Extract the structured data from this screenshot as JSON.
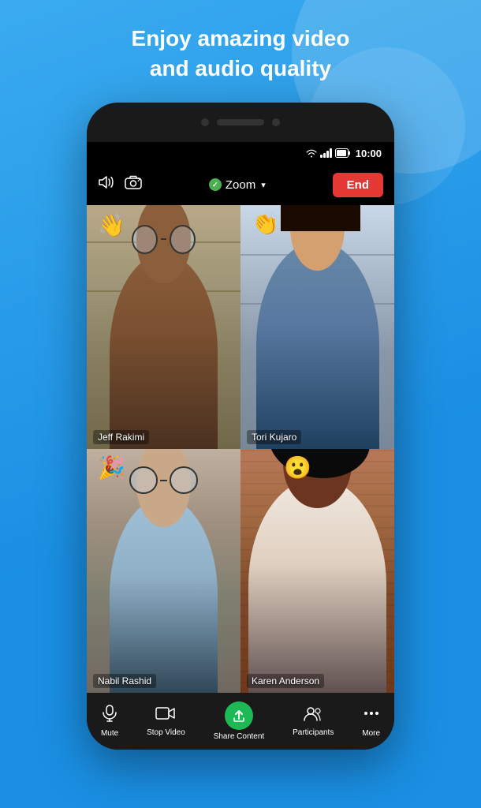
{
  "headline": {
    "line1": "Enjoy amazing video",
    "line2": "and audio quality"
  },
  "status_bar": {
    "time": "10:00"
  },
  "toolbar": {
    "zoom_label": "Zoom",
    "end_label": "End"
  },
  "participants": [
    {
      "name": "Jeff Rakimi",
      "emoji": "👋",
      "emoji_class": "emoji-p1",
      "active": false,
      "scene": "books"
    },
    {
      "name": "Tori Kujaro",
      "emoji": "👏",
      "emoji_class": "emoji-p2",
      "active": true,
      "scene": "light"
    },
    {
      "name": "Nabil Rashid",
      "emoji": "🎉",
      "emoji_class": "emoji-p3",
      "active": false,
      "scene": "warm"
    },
    {
      "name": "Karen Anderson",
      "emoji": "😮",
      "emoji_class": "emoji-p4",
      "active": false,
      "scene": "brick"
    }
  ],
  "bottom_nav": [
    {
      "id": "mute",
      "icon": "🎤",
      "label": "Mute"
    },
    {
      "id": "stop-video",
      "icon": "📹",
      "label": "Stop Video"
    },
    {
      "id": "share-content",
      "icon": "↑",
      "label": "Share Content",
      "special": true
    },
    {
      "id": "participants",
      "icon": "👥",
      "label": "Participants"
    },
    {
      "id": "more",
      "icon": "•••",
      "label": "More"
    }
  ]
}
